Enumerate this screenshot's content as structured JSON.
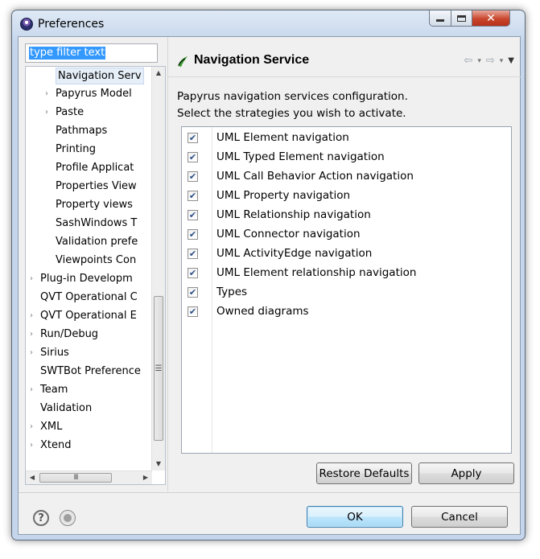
{
  "window": {
    "title": "Preferences"
  },
  "filter": {
    "value": "type filter text"
  },
  "tree": {
    "items": [
      {
        "label": "Navigation Serv",
        "level": 2,
        "expandable": false,
        "selected": true
      },
      {
        "label": "Papyrus Model",
        "level": 2,
        "expandable": true,
        "selected": false
      },
      {
        "label": "Paste",
        "level": 2,
        "expandable": true,
        "selected": false
      },
      {
        "label": "Pathmaps",
        "level": 2,
        "expandable": false,
        "selected": false
      },
      {
        "label": "Printing",
        "level": 2,
        "expandable": false,
        "selected": false
      },
      {
        "label": "Profile Applicat",
        "level": 2,
        "expandable": false,
        "selected": false
      },
      {
        "label": "Properties View",
        "level": 2,
        "expandable": false,
        "selected": false
      },
      {
        "label": "Property views",
        "level": 2,
        "expandable": false,
        "selected": false
      },
      {
        "label": "SashWindows T",
        "level": 2,
        "expandable": false,
        "selected": false
      },
      {
        "label": "Validation prefe",
        "level": 2,
        "expandable": false,
        "selected": false
      },
      {
        "label": "Viewpoints Con",
        "level": 2,
        "expandable": false,
        "selected": false
      },
      {
        "label": "Plug-in Developm",
        "level": 1,
        "expandable": true,
        "selected": false
      },
      {
        "label": "QVT Operational C",
        "level": 1,
        "expandable": false,
        "selected": false
      },
      {
        "label": "QVT Operational E",
        "level": 1,
        "expandable": true,
        "selected": false
      },
      {
        "label": "Run/Debug",
        "level": 1,
        "expandable": true,
        "selected": false
      },
      {
        "label": "Sirius",
        "level": 1,
        "expandable": true,
        "selected": false
      },
      {
        "label": "SWTBot Preference",
        "level": 1,
        "expandable": false,
        "selected": false
      },
      {
        "label": "Team",
        "level": 1,
        "expandable": true,
        "selected": false
      },
      {
        "label": "Validation",
        "level": 1,
        "expandable": false,
        "selected": false
      },
      {
        "label": "XML",
        "level": 1,
        "expandable": true,
        "selected": false
      },
      {
        "label": "Xtend",
        "level": 1,
        "expandable": true,
        "selected": false
      }
    ]
  },
  "page": {
    "title": "Navigation Service",
    "description_line1": "Papyrus navigation services configuration.",
    "description_line2": "Select the strategies you wish to activate."
  },
  "strategies": [
    {
      "label": "UML Element navigation",
      "checked": true
    },
    {
      "label": "UML Typed Element navigation",
      "checked": true
    },
    {
      "label": "UML Call Behavior Action navigation",
      "checked": true
    },
    {
      "label": "UML Property navigation",
      "checked": true
    },
    {
      "label": "UML Relationship navigation",
      "checked": true
    },
    {
      "label": "UML Connector navigation",
      "checked": true
    },
    {
      "label": "UML ActivityEdge navigation",
      "checked": true
    },
    {
      "label": "UML Element relationship navigation",
      "checked": true
    },
    {
      "label": "Types",
      "checked": true
    },
    {
      "label": "Owned diagrams",
      "checked": true
    }
  ],
  "buttons": {
    "restore_defaults": "Restore Defaults",
    "apply": "Apply",
    "ok": "OK",
    "cancel": "Cancel"
  },
  "glyphs": {
    "expand": "›",
    "check": "✔",
    "help": "?",
    "close": "✕",
    "scroll_up": "▲",
    "scroll_down": "▼",
    "scroll_left": "◀",
    "scroll_right": "▶",
    "grip_v": "☰",
    "grip_h": "III",
    "nav_back": "⇦",
    "nav_forward": "⇨",
    "dropdown": "▾",
    "view_menu": "▼"
  }
}
